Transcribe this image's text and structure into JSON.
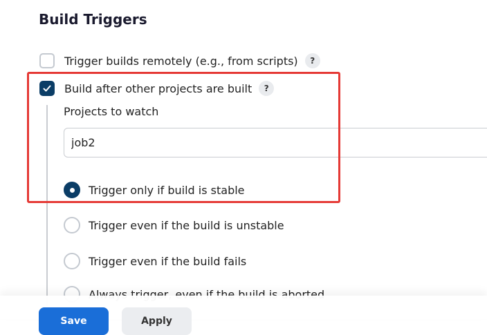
{
  "section": {
    "title": "Build Triggers"
  },
  "options": {
    "trigger_remote": {
      "label": "Trigger builds remotely (e.g., from scripts)",
      "checked": false,
      "help": "?"
    },
    "build_after": {
      "label": "Build after other projects are built",
      "checked": true,
      "help": "?"
    }
  },
  "projects": {
    "label": "Projects to watch",
    "value": "job2"
  },
  "radios": [
    {
      "label": "Trigger only if build is stable",
      "selected": true
    },
    {
      "label": "Trigger even if the build is unstable",
      "selected": false
    },
    {
      "label": "Trigger even if the build fails",
      "selected": false
    },
    {
      "label": "Always trigger, even if the build is aborted",
      "selected": false
    }
  ],
  "footer": {
    "save_label": "Save",
    "apply_label": "Apply"
  },
  "colors": {
    "accent": "#0b3d66",
    "highlight": "#e53935",
    "primary_button": "#1a6ed8"
  }
}
